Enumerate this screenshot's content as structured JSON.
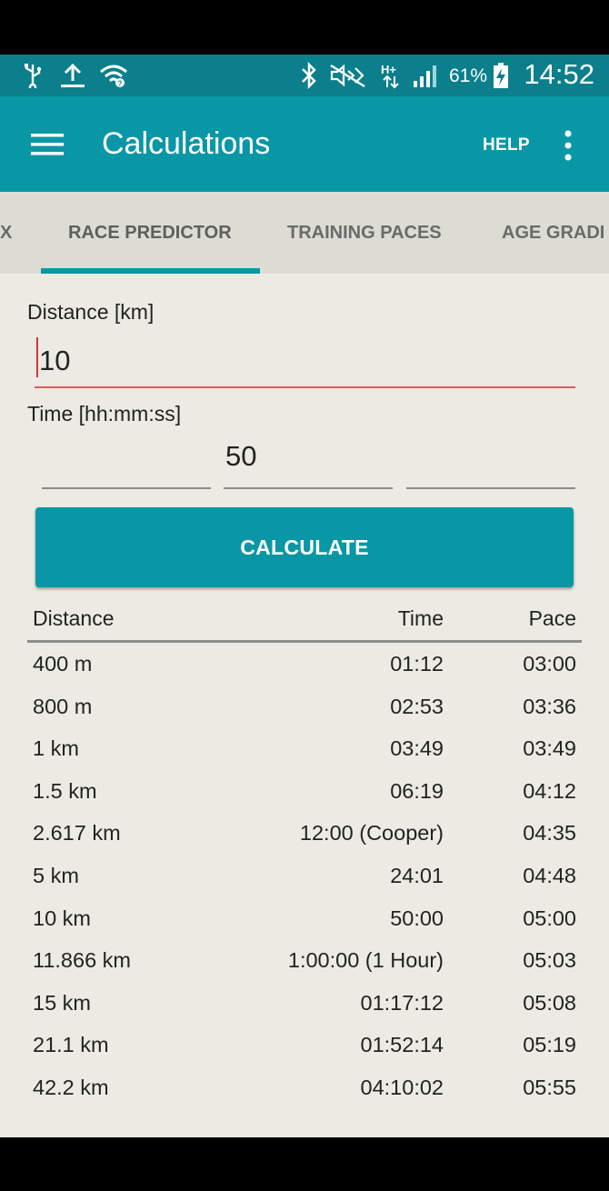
{
  "status_bar": {
    "battery": "61%",
    "clock": "14:52",
    "icons": [
      "usb-icon",
      "upload-icon",
      "wifi-icon",
      "bluetooth-icon",
      "mute-icon",
      "network-hplus-icon",
      "signal-icon",
      "battery-charging-icon"
    ]
  },
  "app_bar": {
    "title": "Calculations",
    "help_label": "HELP",
    "menu_icon": "hamburger-menu-icon",
    "overflow_icon": "more-vertical-icon"
  },
  "tabs": [
    {
      "label": "X"
    },
    {
      "label": "RACE PREDICTOR",
      "active": true
    },
    {
      "label": "TRAINING PACES"
    },
    {
      "label": "AGE GRADI"
    }
  ],
  "form": {
    "distance_label": "Distance [km]",
    "distance_value": "10",
    "time_label": "Time [hh:mm:ss]",
    "time_hours": "",
    "time_minutes": "50",
    "time_seconds": "",
    "calculate_label": "CALCULATE"
  },
  "results": {
    "headers": {
      "distance": "Distance",
      "time": "Time",
      "pace": "Pace"
    },
    "rows": [
      {
        "distance": "400 m",
        "time": "01:12",
        "pace": "03:00"
      },
      {
        "distance": "800 m",
        "time": "02:53",
        "pace": "03:36"
      },
      {
        "distance": "1 km",
        "time": "03:49",
        "pace": "03:49"
      },
      {
        "distance": "1.5 km",
        "time": "06:19",
        "pace": "04:12"
      },
      {
        "distance": "2.617 km",
        "time": "12:00 (Cooper)",
        "pace": "04:35"
      },
      {
        "distance": "5 km",
        "time": "24:01",
        "pace": "04:48"
      },
      {
        "distance": "10 km",
        "time": "50:00",
        "pace": "05:00"
      },
      {
        "distance": "11.866 km",
        "time": "1:00:00 (1 Hour)",
        "pace": "05:03"
      },
      {
        "distance": "15 km",
        "time": "01:17:12",
        "pace": "05:08"
      },
      {
        "distance": "21.1 km",
        "time": "01:52:14",
        "pace": "05:19"
      },
      {
        "distance": "42.2 km",
        "time": "04:10:02",
        "pace": "05:55"
      }
    ]
  },
  "colors": {
    "primary": "#0a97a5",
    "status_bar": "#0b7f8b",
    "tab_bar": "#dcdcd5",
    "background": "#ecebe3",
    "error_underline": "#e05a5a"
  }
}
